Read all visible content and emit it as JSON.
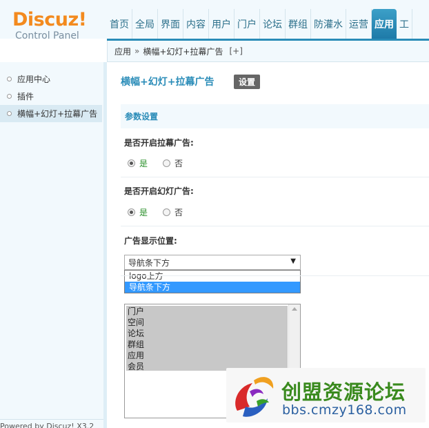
{
  "header": {
    "logo_main": "Discuz!",
    "logo_sub": "Control Panel",
    "nav": [
      {
        "label": "首页",
        "active": false
      },
      {
        "label": "全局",
        "active": false
      },
      {
        "label": "界面",
        "active": false
      },
      {
        "label": "内容",
        "active": false
      },
      {
        "label": "用户",
        "active": false
      },
      {
        "label": "门户",
        "active": false
      },
      {
        "label": "论坛",
        "active": false
      },
      {
        "label": "群组",
        "active": false
      },
      {
        "label": "防灌水",
        "active": false
      },
      {
        "label": "运营",
        "active": false
      },
      {
        "label": "应用",
        "active": true
      },
      {
        "label": "工",
        "active": false
      }
    ]
  },
  "breadcrumb": {
    "root": "应用",
    "separator": "»",
    "current": "横幅+幻灯+拉幕广告",
    "add": "[+]"
  },
  "sidebar": {
    "items": [
      {
        "label": "应用中心",
        "active": false
      },
      {
        "label": "插件",
        "active": false
      },
      {
        "label": "横幅+幻灯+拉幕广告",
        "active": true
      }
    ],
    "powered": "Powered by Discuz! X3.2"
  },
  "main": {
    "title": "横幅+幻灯+拉幕广告",
    "settings_label": "设置",
    "section_title": "参数设置",
    "field1": {
      "label": "是否开启拉幕广告:",
      "yes": "是",
      "no": "否"
    },
    "field2": {
      "label": "是否开启幻灯广告:",
      "yes": "是",
      "no": "否"
    },
    "field3": {
      "label": "广告显示位置:",
      "selected": "导航条下方",
      "options": [
        "logo上方",
        "导航条下方"
      ]
    },
    "listbox_options": [
      "门户",
      "空间",
      "论坛",
      "群组",
      "应用",
      "会员"
    ]
  },
  "watermark": {
    "title": "创盟资源论坛",
    "url": "bbs.cmzy168.com"
  },
  "colors": {
    "accent": "#2a8cb8",
    "logo": "#f38a1e",
    "selection": "#3399ff",
    "yes_green": "#2a8f2a"
  }
}
